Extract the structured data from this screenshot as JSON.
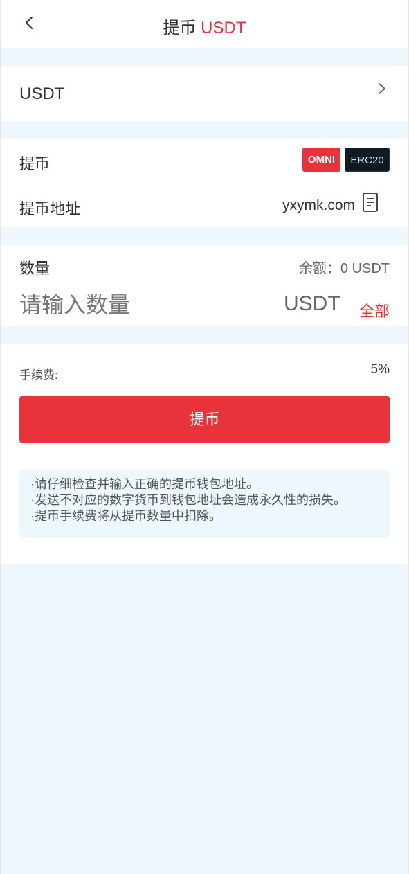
{
  "header": {
    "title_prefix": "提币",
    "title_coin": "USDT",
    "accent_color": "#e8333a"
  },
  "coin_selector": {
    "value": "USDT",
    "icon": "chevron-right-icon"
  },
  "withdraw": {
    "label": "提币",
    "networks": [
      {
        "label": "OMNI",
        "selected": true,
        "color": "#e8333a"
      },
      {
        "label": "ERC20",
        "selected": false,
        "color": "#0f1a22"
      }
    ],
    "address_label": "提币地址",
    "address_value": "yxymk.com",
    "address_icon": "document-icon"
  },
  "amount": {
    "label": "数量",
    "balance": "余额：0 USDT",
    "placeholder": "请输入数量",
    "value": "",
    "unit": "USDT",
    "all_label": "全部"
  },
  "fee": {
    "label": "手续费:",
    "value": "5%"
  },
  "submit_label": "提币",
  "notices": [
    "·请仔细检查并输入正确的提币钱包地址。",
    "·发送不对应的数字货币到钱包地址会造成永久性的损失。",
    "·提币手续费将从提币数量中扣除。"
  ],
  "colors": {
    "page_bg": "#eef6fe",
    "brand": "#e8333a"
  }
}
